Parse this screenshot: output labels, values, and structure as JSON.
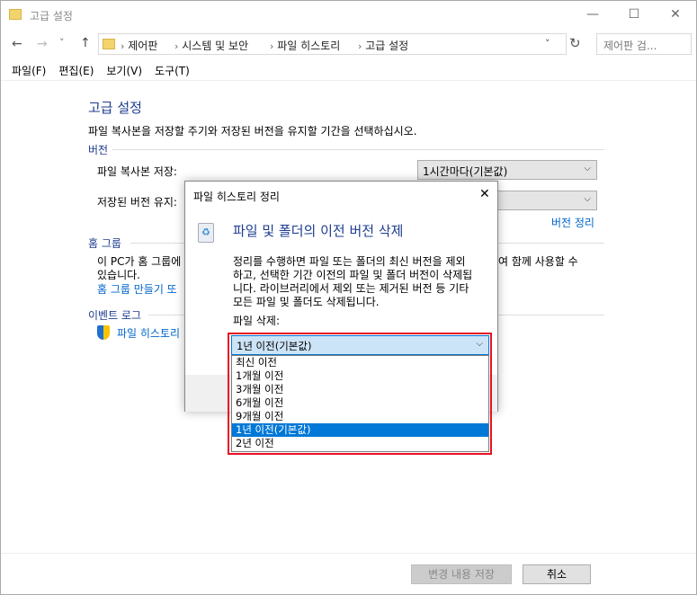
{
  "window": {
    "title": "고급 설정",
    "minimize": "—",
    "maximize": "☐",
    "close": "✕"
  },
  "nav": {
    "back": "←",
    "forward": "→",
    "recent": "˅",
    "up": "↑",
    "breadcrumbs": [
      "제어판",
      "시스템 및 보안",
      "파일 히스토리",
      "고급 설정"
    ],
    "refresh": "↻",
    "search_placeholder": "제어판 검...",
    "search_icon": "🔍"
  },
  "menu": [
    "파일(F)",
    "편집(E)",
    "보기(V)",
    "도구(T)"
  ],
  "main": {
    "heading": "고급 설정",
    "description": "파일 복사본을 저장할 주기와 저장된 버전을 유지할 기간을 선택하십시오.",
    "versions_label": "버전",
    "save_copies_label": "파일 복사본 저장:",
    "save_copies_value": "1시간마다(기본값)",
    "keep_versions_label": "저장된 버전 유지:",
    "cleanup_link": "버전 정리",
    "homegroup_label": "홈 그룹",
    "homegroup_text_left": "이 PC가 홈 그룹에",
    "homegroup_text_right": "여 함께 사용할 수",
    "homegroup_text_line2": "있습니다.",
    "homegroup_link": "홈 그룹 만들기 또",
    "eventlog_label": "이벤트 로그",
    "eventlog_link": "파일 히스토리",
    "save_button": "변경 내용 저장",
    "cancel_button": "취소"
  },
  "dialog": {
    "title": "파일 히스토리 정리",
    "close": "✕",
    "heading": "파일 및 폴더의 이전 버전 삭제",
    "body": [
      "정리를 수행하면 파일 또는 폴더의 최신 버전을 제외",
      "하고, 선택한 기간 이전의 파일 및 폴더 버전이 삭제됩",
      "니다. 라이브러리에서 제외 또는 제거된 버전 등 기타",
      "모든 파일 및 폴더도 삭제됩니다."
    ],
    "delete_label": "파일 삭제:",
    "selected": "1년 이전(기본값)",
    "options": [
      "최신 이전",
      "1개월 이전",
      "3개월 이전",
      "6개월 이전",
      "9개월 이전",
      "1년 이전(기본값)",
      "2년 이전"
    ],
    "selected_index": 5,
    "highlight_color": "#e81123"
  }
}
